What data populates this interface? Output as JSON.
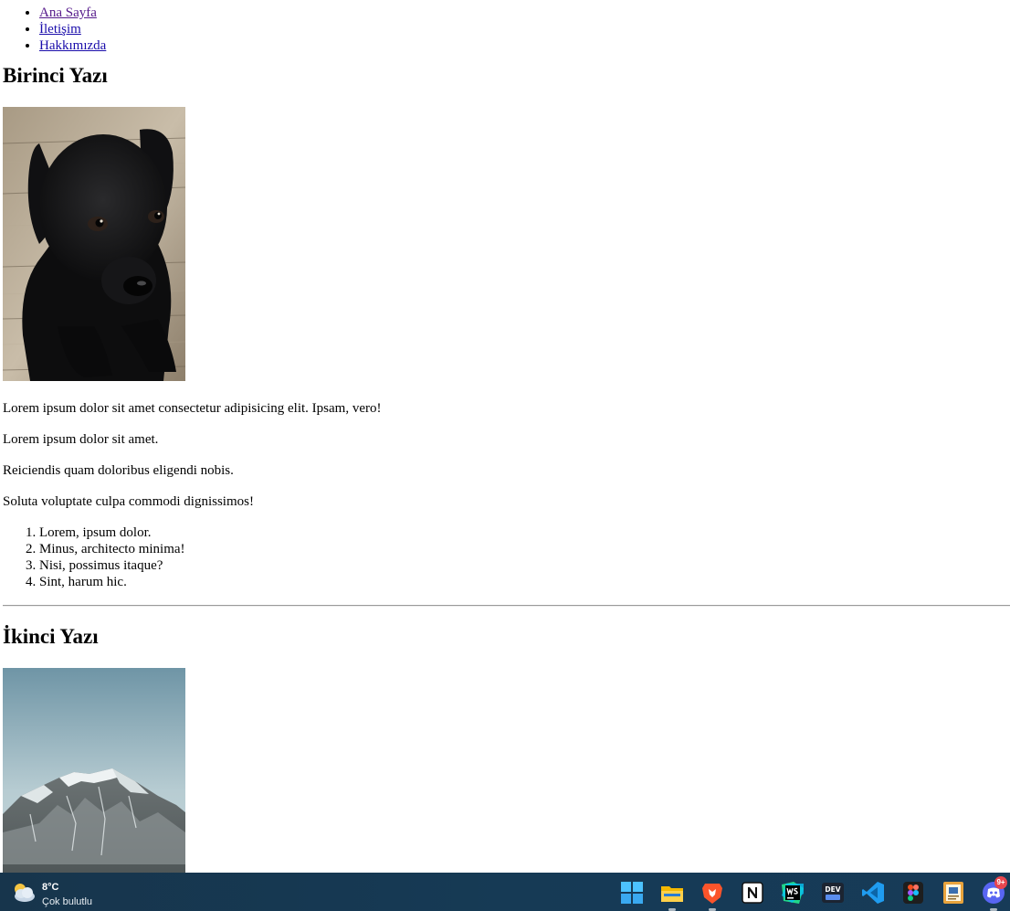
{
  "nav": {
    "items": [
      {
        "label": "Ana Sayfa"
      },
      {
        "label": "İletişim"
      },
      {
        "label": "Hakkımızda"
      }
    ]
  },
  "posts": [
    {
      "title": "Birinci Yazı",
      "image": "black-puppy-photo",
      "paragraphs": [
        "Lorem ipsum dolor sit amet consectetur adipisicing elit. Ipsam, vero!",
        "Lorem ipsum dolor sit amet.",
        "Reiciendis quam doloribus eligendi nobis.",
        "Soluta voluptate culpa commodi dignissimos!"
      ],
      "list": [
        "Lorem, ipsum dolor.",
        "Minus, architecto minima!",
        "Nisi, possimus itaque?",
        "Sint, harum hic."
      ]
    },
    {
      "title": "İkinci Yazı",
      "image": "snowy-mountain-photo"
    }
  ],
  "taskbar": {
    "weather": {
      "temp": "8°C",
      "condition": "Çok bulutlu",
      "icon": "cloudy-icon"
    },
    "apps": [
      {
        "name": "start-icon"
      },
      {
        "name": "file-explorer-icon"
      },
      {
        "name": "brave-browser-icon"
      },
      {
        "name": "notion-icon"
      },
      {
        "name": "webstorm-icon"
      },
      {
        "name": "dev-home-icon"
      },
      {
        "name": "vscode-icon"
      },
      {
        "name": "figma-icon"
      },
      {
        "name": "notepad-app-icon"
      },
      {
        "name": "discord-icon"
      }
    ],
    "discord_badge": "9+"
  }
}
